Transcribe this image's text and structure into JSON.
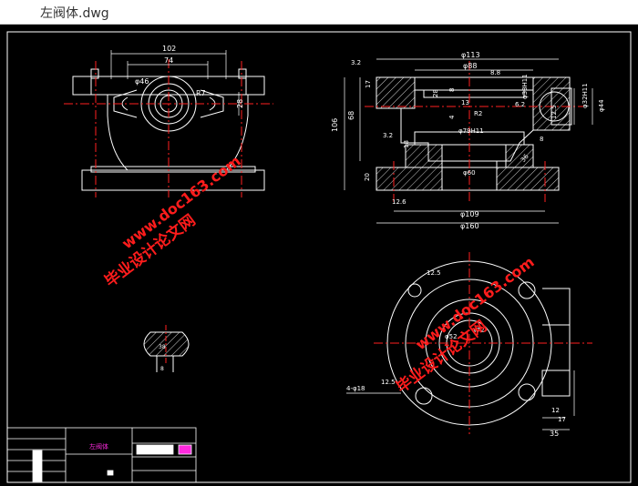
{
  "window": {
    "title": "左阀体.dwg"
  },
  "colors": {
    "canvas": "#000000",
    "line": "#ffffff",
    "center": "#ff2020",
    "dim": "#ffffff",
    "watermark": "#ff1c1c",
    "hatch": "#ffffff"
  },
  "top_view": {
    "dim_overall": "102",
    "dim_inner": "74",
    "dim_phi": "φ46",
    "dim_r": "R7",
    "dim_right": "28"
  },
  "section_view": {
    "dim_phi113": "φ113",
    "dim_phi88": "φ88",
    "dim_88": "8.8",
    "dim_32a": "3.2",
    "dim_17": "17",
    "dim_28": "28",
    "dim_8": "8",
    "dim_13": "13",
    "dim_4": "4",
    "dim_r2": "R2",
    "dim_68": "68",
    "dim_106": "106",
    "dim_phi79": "φ79H11",
    "dim_32b": "3.2",
    "dim_18": "18",
    "dim_phi60": "φ60",
    "dim_20": "20",
    "dim_126": "12.6",
    "dim_phi109": "φ109",
    "dim_phi160": "φ160",
    "dim_phi38": "φ38H11",
    "dim_phi32": "φ32H11",
    "dim_phi44": "φ44",
    "dim_62": "6.2",
    "dim_125": "12.5",
    "dim_36": "36",
    "dim_8b": "8"
  },
  "plan_view": {
    "dim_125": "12.5",
    "dim_phi52": "φ52",
    "dim_phi72": "φ72",
    "dim_4phi18": "4-φ18",
    "dim_125b": "12.5",
    "dim_12": "12",
    "dim_17": "17",
    "dim_35": "35"
  },
  "detail_view": {
    "dim_a": "38",
    "dim_b": "8"
  },
  "title_block": {
    "drawing_name": "左阀体"
  },
  "watermark": {
    "line1": "毕业设计论文网",
    "line2": "www.doc163.com"
  }
}
